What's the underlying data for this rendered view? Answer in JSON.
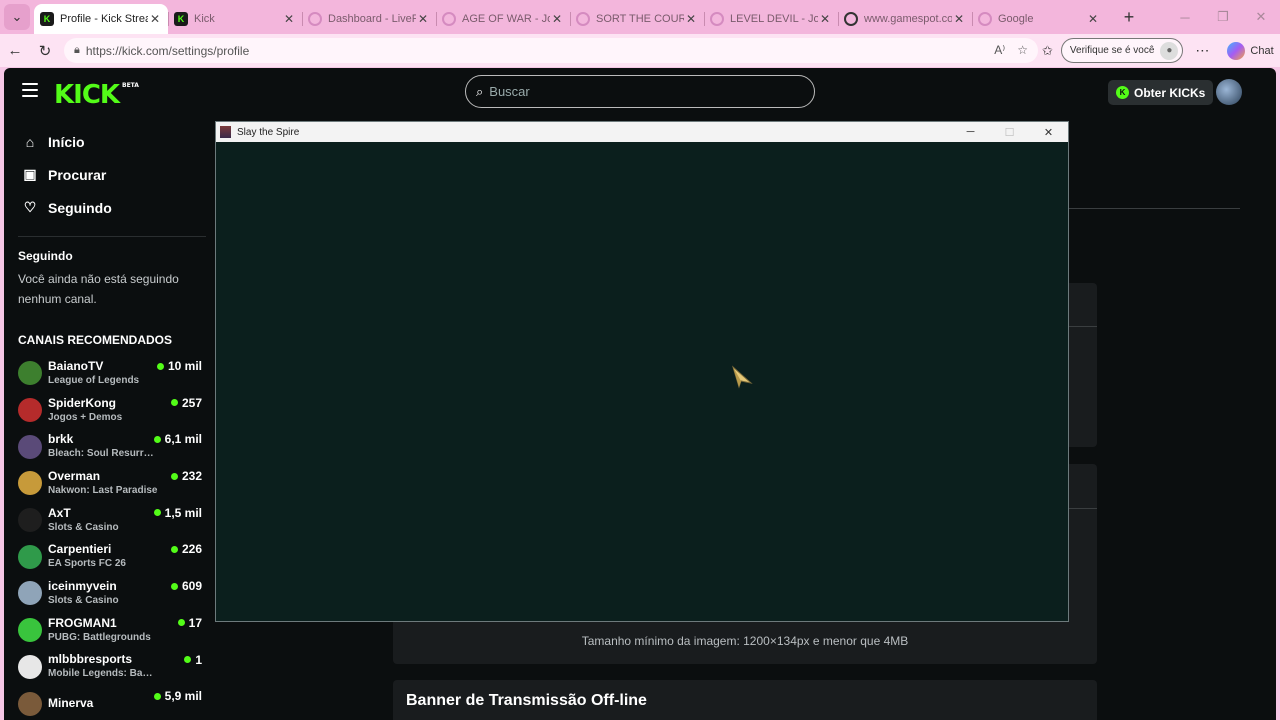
{
  "browser": {
    "tabs": [
      {
        "title": "Profile - Kick Stream",
        "active": true,
        "fav": "K",
        "fav_color": "#53fc18"
      },
      {
        "title": "Kick",
        "active": false,
        "fav": "K",
        "fav_color": "#53fc18"
      },
      {
        "title": "Dashboard - LivePix",
        "active": false,
        "fav": "",
        "fav_color": "#d58bc0"
      },
      {
        "title": "AGE OF WAR - Jogo",
        "active": false,
        "fav": "",
        "fav_color": "#d58bc0"
      },
      {
        "title": "SORT THE COURT!",
        "active": false,
        "fav": "",
        "fav_color": "#d58bc0"
      },
      {
        "title": "LEVEL DEVIL - Jogo",
        "active": false,
        "fav": "",
        "fav_color": "#d58bc0"
      },
      {
        "title": "www.gamespot.com",
        "active": false,
        "fav": "",
        "fav_color": "#333333"
      },
      {
        "title": "Google",
        "active": false,
        "fav": "",
        "fav_color": "#d58bc0"
      }
    ],
    "url": "https://kick.com/settings/profile",
    "verify_label": "Verifique se é você",
    "chat_label": "Chat"
  },
  "kick": {
    "logo": "KICK",
    "logo_badge": "BETA",
    "search_placeholder": "Buscar",
    "get_kicks": "Obter KICKs",
    "nav": [
      {
        "label": "Início",
        "icon": "home-icon",
        "glyph": "⌂"
      },
      {
        "label": "Procurar",
        "icon": "browse-icon",
        "glyph": "▣"
      },
      {
        "label": "Seguindo",
        "icon": "heart-icon",
        "glyph": "♡"
      }
    ],
    "following_title": "Seguindo",
    "following_empty": "Você ainda não está seguindo nenhum canal.",
    "recommended_title": "CANAIS RECOMENDADOS",
    "channels": [
      {
        "name": "BaianoTV",
        "category": "League of Legends",
        "viewers": "10 mil",
        "color": "#3d7f2e"
      },
      {
        "name": "SpiderKong",
        "category": "Jogos + Demos",
        "viewers": "257",
        "color": "#b52b2b"
      },
      {
        "name": "brkk",
        "category": "Bleach: Soul Resurr…",
        "viewers": "6,1 mil",
        "color": "#5a4a78"
      },
      {
        "name": "Overman",
        "category": "Nakwon: Last Paradise",
        "viewers": "232",
        "color": "#c79a3a"
      },
      {
        "name": "AxT",
        "category": "Slots & Casino",
        "viewers": "1,5 mil",
        "color": "#1e1e1e"
      },
      {
        "name": "Carpentieri",
        "category": "EA Sports FC 26",
        "viewers": "226",
        "color": "#2f9a4a"
      },
      {
        "name": "iceinmyvein",
        "category": "Slots & Casino",
        "viewers": "609",
        "color": "#8fa4b8"
      },
      {
        "name": "FROGMAN1",
        "category": "PUBG: Battlegrounds",
        "viewers": "17",
        "color": "#39c43d"
      },
      {
        "name": "mlbbbresports",
        "category": "Mobile Legends: Bang Ba…",
        "viewers": "1",
        "color": "#e7e7e7"
      },
      {
        "name": "Minerva",
        "category": "",
        "viewers": "5,9 mil",
        "color": "#7a5a3a"
      }
    ],
    "min_image_size": "Tamanho mínimo da imagem: 1200×134px e menor que 4MB",
    "offline_banner_title": "Banner de Transmissão Off-line"
  },
  "game_window": {
    "title": "Slay the Spire"
  }
}
